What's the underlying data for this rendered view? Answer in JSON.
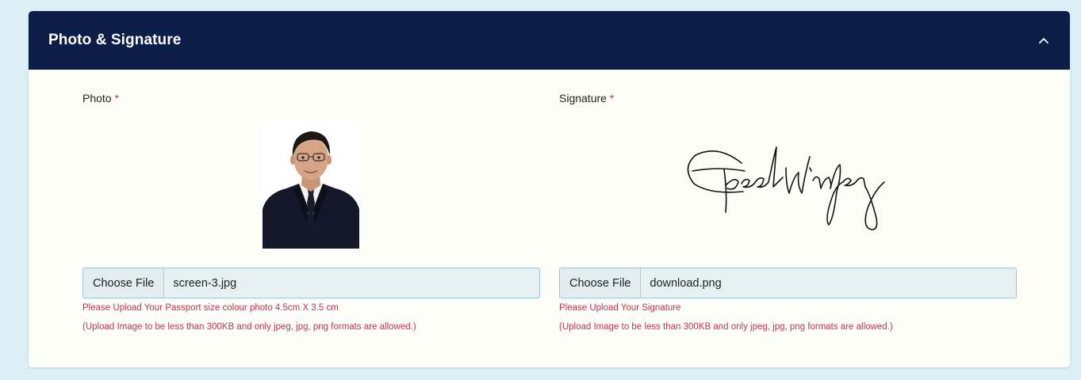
{
  "section": {
    "title": "Photo & Signature",
    "collapse_icon": "chevron-up-icon"
  },
  "photo": {
    "label": "Photo",
    "required_mark": "*",
    "choose_label": "Choose File",
    "file_name": "screen-3.jpg",
    "hint1": "Please Upload Your Passport size colour photo 4.5cm X 3.5 cm",
    "hint2": "(Upload Image to be less than 300KB and only jpeg, jpg, png formats are allowed.)"
  },
  "signature": {
    "label": "Signature",
    "required_mark": "*",
    "choose_label": "Choose File",
    "file_name": "download.png",
    "hint1": "Please Upload Your Signature",
    "hint2": "(Upload Image to be less than 300KB and only jpeg, jpg, png formats are allowed.)"
  },
  "colors": {
    "header_bg": "#0c1e47",
    "required": "#d0304c",
    "hint": "#c0344f",
    "page_bg": "#dceff4",
    "card_bg": "#fdfdf8"
  }
}
